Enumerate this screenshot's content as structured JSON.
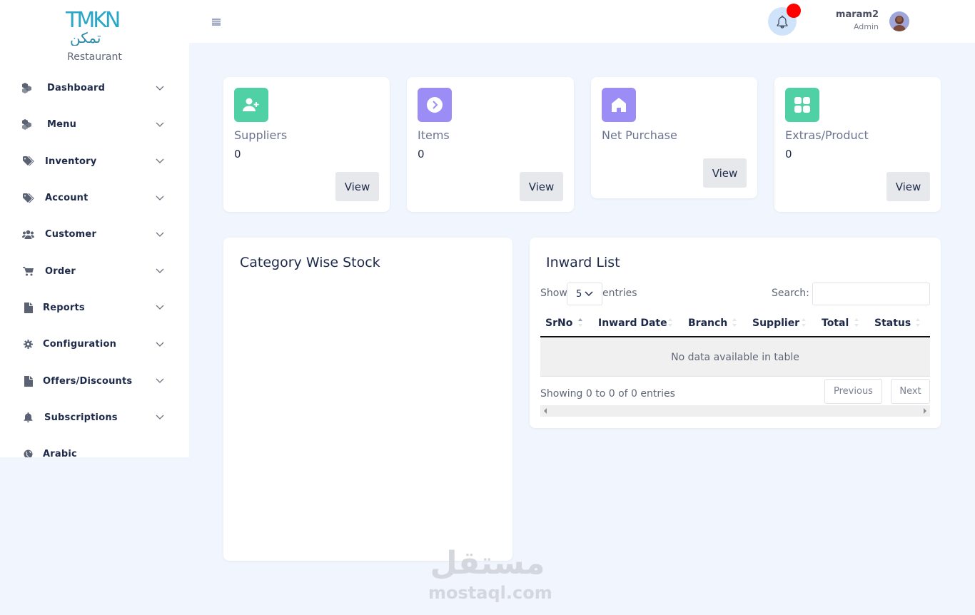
{
  "brand": {
    "logo_latin": "TMKN",
    "logo_arabic": "تمكن",
    "subtitle": "Restaurant"
  },
  "sidebar": {
    "items": [
      {
        "label": "Dashboard",
        "icon": "cubes-icon"
      },
      {
        "label": "Menu",
        "icon": "cubes-icon"
      },
      {
        "label": "Inventory",
        "icon": "tags-icon"
      },
      {
        "label": "Account",
        "icon": "tags-icon"
      },
      {
        "label": "Customer",
        "icon": "users-icon"
      },
      {
        "label": "Order",
        "icon": "cart-icon"
      },
      {
        "label": "Reports",
        "icon": "file-icon"
      },
      {
        "label": "Configuration",
        "icon": "gear-icon"
      },
      {
        "label": "Offers/Discounts",
        "icon": "file-icon"
      },
      {
        "label": "Subscriptions",
        "icon": "bell-icon"
      },
      {
        "label": "Arabic",
        "icon": "globe-icon"
      }
    ]
  },
  "header": {
    "user_name": "maram2",
    "user_role": "Admin",
    "notification_color": "#ff0000"
  },
  "stats": [
    {
      "title": "Suppliers",
      "value": "0",
      "button": "View",
      "icon": "user-plus-icon",
      "color": "#4fd1a5"
    },
    {
      "title": "Items",
      "value": "0",
      "button": "View",
      "icon": "chevron-circle-icon",
      "color": "#9b8cf6"
    },
    {
      "title": "Net Purchase",
      "value": "",
      "button": "View",
      "icon": "home-icon",
      "color": "#9b8cf6"
    },
    {
      "title": "Extras/Product",
      "value": "0",
      "button": "View",
      "icon": "grid-icon",
      "color": "#4fd1a5"
    }
  ],
  "category_panel": {
    "title": "Category Wise Stock"
  },
  "inward": {
    "title": "Inward List",
    "show_label": "Show",
    "length_value": "5",
    "entries_label": "entries",
    "search_label": "Search:",
    "columns": [
      "SrNo",
      "Inward Date",
      "Branch",
      "Supplier",
      "Total",
      "Status"
    ],
    "empty_text": "No data available in table",
    "info_text": "Showing 0 to 0 of 0 entries",
    "prev_label": "Previous",
    "next_label": "Next"
  },
  "watermark": {
    "arabic": "مستقل",
    "latin": "mostaql.com"
  }
}
